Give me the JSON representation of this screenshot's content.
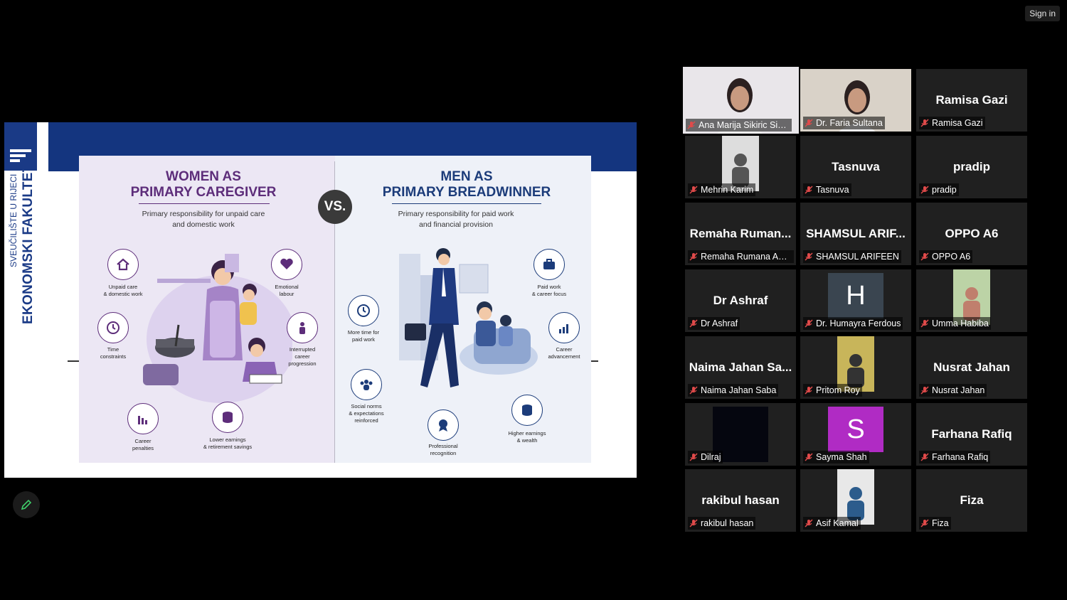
{
  "top": {
    "sign_in": "Sign in"
  },
  "slide": {
    "university_line1": "SVEUČILIŠTE U RIJECI",
    "university_line2": "EKONOMSKI FAKULTET",
    "vs": "VS.",
    "women": {
      "title_line1": "WOMEN AS",
      "title_line2": "PRIMARY CAREGIVER",
      "subtitle_line1": "Primary responsibility for unpaid care",
      "subtitle_line2": "and domestic work",
      "items": [
        {
          "icon": "house-icon",
          "label1": "Unpaid care",
          "label2": "& domestic work"
        },
        {
          "icon": "heart-icon",
          "label1": "Emotional",
          "label2": "labour"
        },
        {
          "icon": "clock-icon",
          "label1": "Time",
          "label2": "constraints"
        },
        {
          "icon": "person-icon",
          "label1": "Interrupted",
          "label2": "career",
          "label3": "progression"
        },
        {
          "icon": "chart-down-icon",
          "label1": "Career",
          "label2": "penalties"
        },
        {
          "icon": "coins-icon",
          "label1": "Lower earnings",
          "label2": "& retirement savings"
        }
      ]
    },
    "men": {
      "title_line1": "MEN AS",
      "title_line2": "PRIMARY BREADWINNER",
      "subtitle_line1": "Primary responsibility for paid work",
      "subtitle_line2": "and financial provision",
      "items": [
        {
          "icon": "briefcase-icon",
          "label1": "Paid work",
          "label2": "& career focus"
        },
        {
          "icon": "clock-icon",
          "label1": "More time for",
          "label2": "paid work"
        },
        {
          "icon": "chart-up-icon",
          "label1": "Career",
          "label2": "advancement"
        },
        {
          "icon": "group-icon",
          "label1": "Social norms",
          "label2": "& expectations",
          "label3": "reinforced"
        },
        {
          "icon": "coins-icon",
          "label1": "Higher earnings",
          "label2": "& wealth"
        },
        {
          "icon": "medal-icon",
          "label1": "Professional",
          "label2": "recognition"
        }
      ]
    }
  },
  "participants": [
    {
      "name": "Ana Marija Sikiric Simcic",
      "type": "video",
      "active": true
    },
    {
      "name": "Dr. Faria Sultana",
      "type": "video"
    },
    {
      "name": "Ramisa Gazi",
      "big": "Ramisa Gazi"
    },
    {
      "name": "Mehrin Karim",
      "type": "photo"
    },
    {
      "name": "Tasnuva",
      "big": "Tasnuva"
    },
    {
      "name": "pradip",
      "big": "pradip"
    },
    {
      "name": "Remaha Rumana Ahm...",
      "big": "Remaha  Ruman..."
    },
    {
      "name": "SHAMSUL ARIFEEN",
      "big": "SHAMSUL  ARIF..."
    },
    {
      "name": "OPPO A6",
      "big": "OPPO A6"
    },
    {
      "name": "Dr Ashraf",
      "big": "Dr Ashraf"
    },
    {
      "name": "Dr. Humayra Ferdous",
      "avatar": "H",
      "avatar_color": "#3a4550"
    },
    {
      "name": "Umma Habiba",
      "type": "photo"
    },
    {
      "name": "Naima Jahan Saba",
      "big": "Naima  Jahan  Sa..."
    },
    {
      "name": "Pritom Roy",
      "type": "photo"
    },
    {
      "name": "Nusrat Jahan",
      "big": "Nusrat Jahan"
    },
    {
      "name": "Dilraj",
      "type": "dark"
    },
    {
      "name": "Sayma Shah",
      "avatar": "S",
      "avatar_color": "#b02bc4"
    },
    {
      "name": "Farhana Rafiq",
      "big": "Farhana Rafiq"
    },
    {
      "name": "rakibul hasan",
      "big": "rakibul hasan"
    },
    {
      "name": "Asif Kamal",
      "type": "photo"
    },
    {
      "name": "Fiza",
      "big": "Fiza"
    }
  ]
}
